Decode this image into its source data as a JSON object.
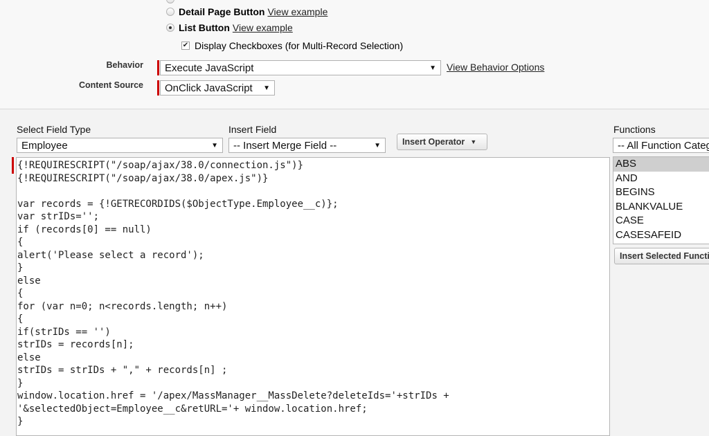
{
  "display_type": {
    "detail_page_button_label": "Detail Page Button",
    "detail_page_button_link": "View example",
    "list_button_label": "List Button",
    "list_button_link": "View example",
    "display_checkboxes_label": "Display Checkboxes (for Multi-Record Selection)",
    "display_checkboxes_checked": true,
    "selected": "List Button"
  },
  "behavior": {
    "label": "Behavior",
    "value": "Execute JavaScript",
    "options_link": "View Behavior Options"
  },
  "content_source": {
    "label": "Content Source",
    "value": "OnClick JavaScript"
  },
  "editor_toolbar": {
    "field_type_label": "Select Field Type",
    "field_type_value": "Employee",
    "insert_field_label": "Insert Field",
    "insert_field_value": "-- Insert Merge Field --",
    "insert_operator_label": "Insert Operator"
  },
  "functions": {
    "label": "Functions",
    "category_value": "-- All Function Categories --",
    "items": [
      "ABS",
      "AND",
      "BEGINS",
      "BLANKVALUE",
      "CASE",
      "CASESAFEID"
    ],
    "selected": "ABS",
    "insert_button_label": "Insert Selected Function"
  },
  "code": {
    "lines": [
      "{!REQUIRESCRIPT(\"/soap/ajax/38.0/connection.js\")}",
      "{!REQUIRESCRIPT(\"/soap/ajax/38.0/apex.js\")}",
      "",
      "var records = {!GETRECORDIDS($ObjectType.Employee__c)};",
      "var strIDs='';",
      "if (records[0] == null)",
      "{",
      "alert('Please select a record');",
      "}",
      "else",
      "{",
      "for (var n=0; n<records.length; n++)",
      "{",
      "if(strIDs == '')",
      "strIDs = records[n];",
      "else",
      "strIDs = strIDs + \",\" + records[n] ;",
      "}",
      "window.location.href = '/apex/MassManager__MassDelete?deleteIds='+strIDs +",
      "'&selectedObject=Employee__c&retURL='+ window.location.href;",
      "}"
    ]
  },
  "colors": {
    "required_bar": "#cc0000",
    "selected_item_bg": "#cfcfcf",
    "page_bg": "#f8f8f8"
  }
}
